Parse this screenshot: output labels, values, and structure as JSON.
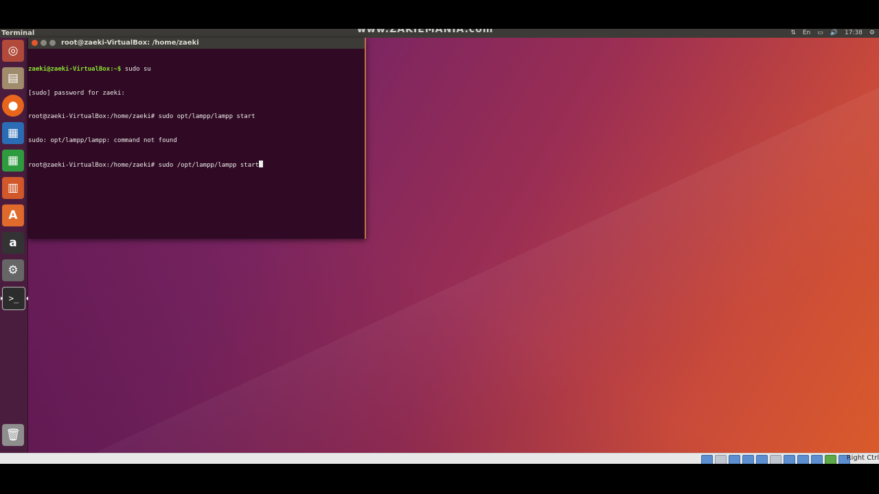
{
  "panel": {
    "app_name": "Terminal",
    "watermark": "www.ZAKIEMANIA.com",
    "clock": "17:38"
  },
  "launcher": {
    "items": [
      {
        "name": "dash-icon",
        "glyph": "◎",
        "color": "#b14a3a"
      },
      {
        "name": "files-icon",
        "glyph": "▤",
        "color": "#a08c6c"
      },
      {
        "name": "firefox-icon",
        "glyph": "●",
        "color": "#e8661c"
      },
      {
        "name": "writer-icon",
        "glyph": "▦",
        "color": "#2b6db5"
      },
      {
        "name": "calc-icon",
        "glyph": "▦",
        "color": "#2f9b3f"
      },
      {
        "name": "impress-icon",
        "glyph": "▥",
        "color": "#d1582a"
      },
      {
        "name": "software-center-icon",
        "glyph": "A",
        "color": "#e06a2b"
      },
      {
        "name": "amazon-icon",
        "glyph": "a",
        "color": "#333333"
      },
      {
        "name": "settings-icon",
        "glyph": "⚙",
        "color": "#666666"
      },
      {
        "name": "terminal-icon",
        "glyph": ">_",
        "color": "#2c2c2c"
      }
    ],
    "trash": {
      "name": "trash-icon",
      "glyph": "🗑",
      "color": "#8e8e8e"
    }
  },
  "terminal": {
    "title": "root@zaeki-VirtualBox: /home/zaeki",
    "lines": [
      {
        "prompt": "zaeki@zaeki-VirtualBox:~$ ",
        "text": "sudo su"
      },
      {
        "prompt": "",
        "text": "[sudo] password for zaeki:"
      },
      {
        "prompt": "",
        "text": "root@zaeki-VirtualBox:/home/zaeki# sudo opt/lampp/lampp start"
      },
      {
        "prompt": "",
        "text": "sudo: opt/lampp/lampp: command not found"
      },
      {
        "prompt": "",
        "text": "root@zaeki-VirtualBox:/home/zaeki# sudo /opt/lampp/lampp start"
      }
    ]
  },
  "vbox_status": {
    "host_key": "Right Ctrl"
  }
}
